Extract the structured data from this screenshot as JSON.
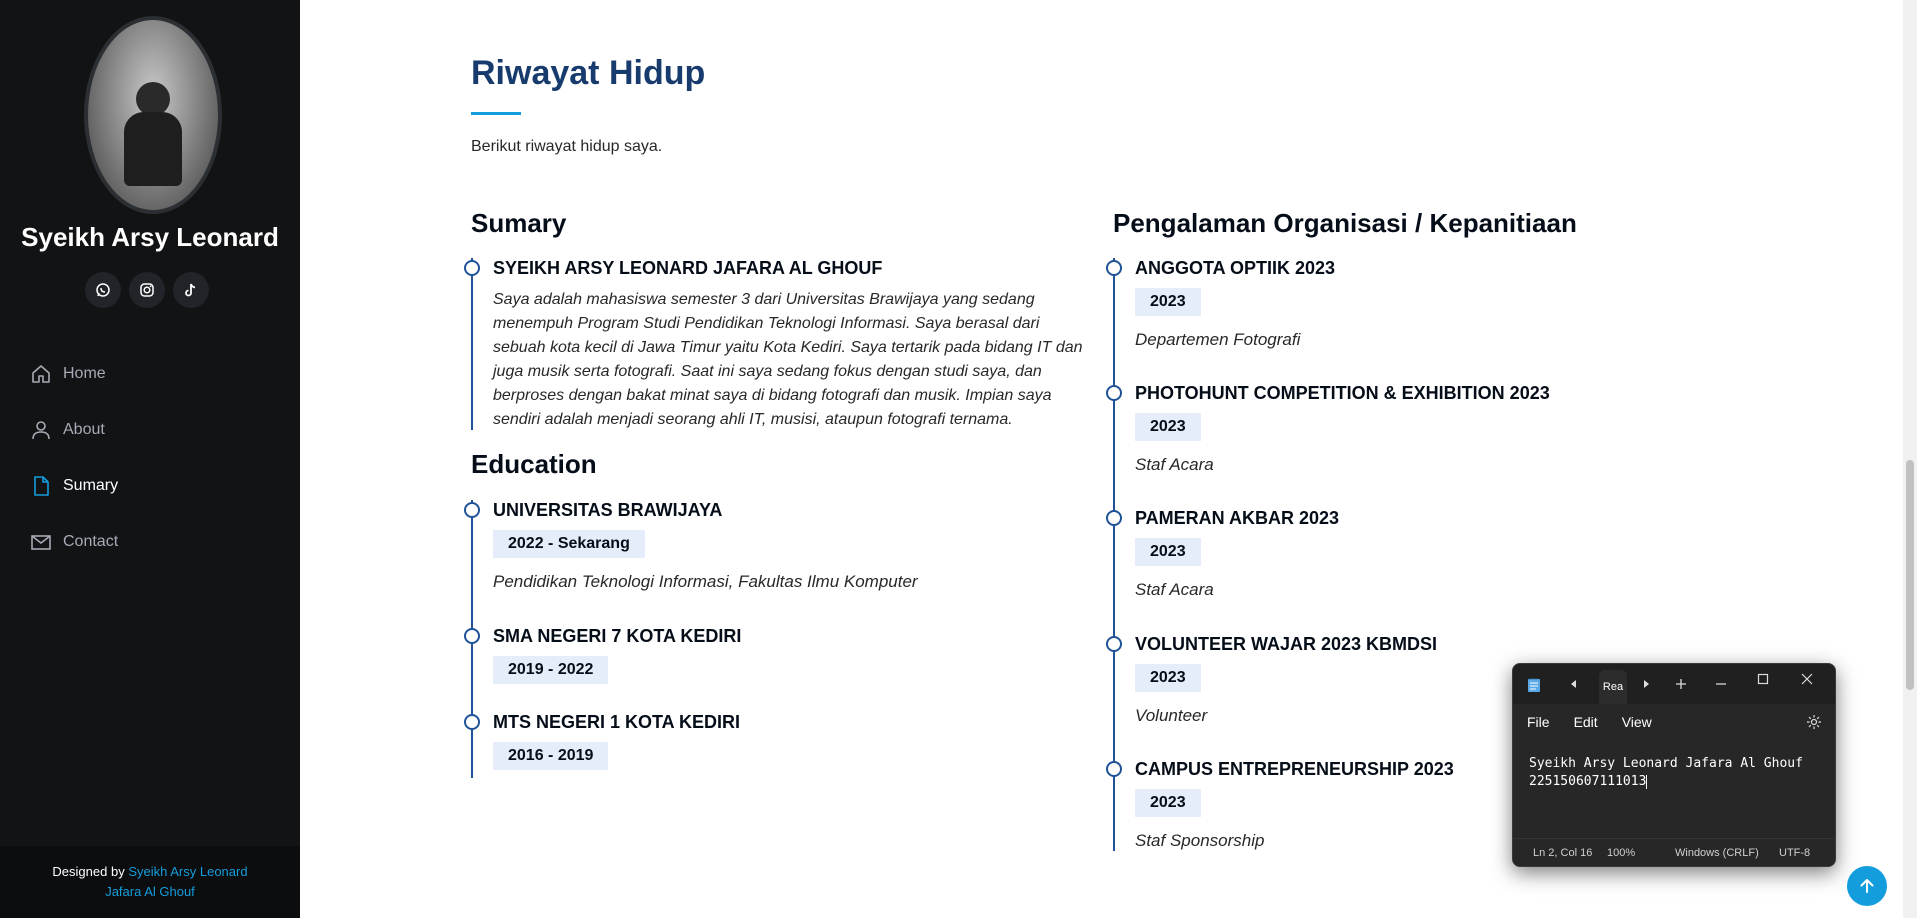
{
  "sidebar": {
    "name": "Syeikh Arsy Leonard",
    "socials": [
      {
        "icon": "whatsapp-icon"
      },
      {
        "icon": "instagram-icon"
      },
      {
        "icon": "tiktok-icon"
      }
    ],
    "nav": [
      {
        "label": "Home",
        "icon": "home-icon"
      },
      {
        "label": "About",
        "icon": "person-icon"
      },
      {
        "label": "Sumary",
        "icon": "document-icon",
        "active": true
      },
      {
        "label": "Contact",
        "icon": "envelope-icon"
      }
    ],
    "footer": {
      "prefix": "Designed by",
      "link_line1": "Syeikh Arsy Leonard",
      "link_line2": "Jafara Al Ghouf"
    }
  },
  "main": {
    "title": "Riwayat Hidup",
    "subtitle": "Berikut riwayat hidup saya.",
    "sumary": {
      "heading": "Sumary",
      "name": "SYEIKH ARSY LEONARD JAFARA AL GHOUF",
      "text": "Saya adalah mahasiswa semester 3 dari Universitas Brawijaya yang sedang menempuh Program Studi Pendidikan Teknologi Informasi. Saya berasal dari sebuah kota kecil di Jawa Timur yaitu Kota Kediri. Saya tertarik pada bidang IT dan juga musik serta fotografi. Saat ini saya sedang fokus dengan studi saya, dan berproses dengan bakat minat saya di bidang fotografi dan musik. Impian saya sendiri adalah menjadi seorang ahli IT, musisi, ataupun fotografi ternama."
    },
    "education": {
      "heading": "Education",
      "items": [
        {
          "title": "UNIVERSITAS BRAWIJAYA",
          "years": "2022 - Sekarang",
          "desc": "Pendidikan Teknologi Informasi, Fakultas Ilmu Komputer"
        },
        {
          "title": "SMA NEGERI 7 KOTA KEDIRI",
          "years": "2019 - 2022"
        },
        {
          "title": "MTS NEGERI 1 KOTA KEDIRI",
          "years": "2016 - 2019"
        }
      ]
    },
    "experience": {
      "heading": "Pengalaman Organisasi / Kepanitiaan",
      "items": [
        {
          "title": "ANGGOTA OPTIIK 2023",
          "year": "2023",
          "role": "Departemen Fotografi"
        },
        {
          "title": "PHOTOHUNT COMPETITION & EXHIBITION 2023",
          "year": "2023",
          "role": "Staf Acara"
        },
        {
          "title": "PAMERAN AKBAR 2023",
          "year": "2023",
          "role": "Staf Acara"
        },
        {
          "title": "VOLUNTEER WAJAR 2023 KBMDSI",
          "year": "2023",
          "role": "Volunteer"
        },
        {
          "title": "CAMPUS ENTREPRENEURSHIP 2023",
          "year": "2023",
          "role": "Staf Sponsorship"
        }
      ]
    }
  },
  "notepad": {
    "tab_label": "Rea",
    "menu": [
      "File",
      "Edit",
      "View"
    ],
    "content_line1": "Syeikh Arsy Leonard Jafara Al Ghouf",
    "content_line2": "225150607111013",
    "status": {
      "position": "Ln 2, Col 16",
      "zoom": "100%",
      "line_ending": "Windows (CRLF)",
      "encoding": "UTF-8"
    }
  },
  "colors": {
    "accent": "#149ddd",
    "navy": "#173b6c",
    "sidebar_bg": "#111315",
    "timeline": "#1f5297"
  }
}
